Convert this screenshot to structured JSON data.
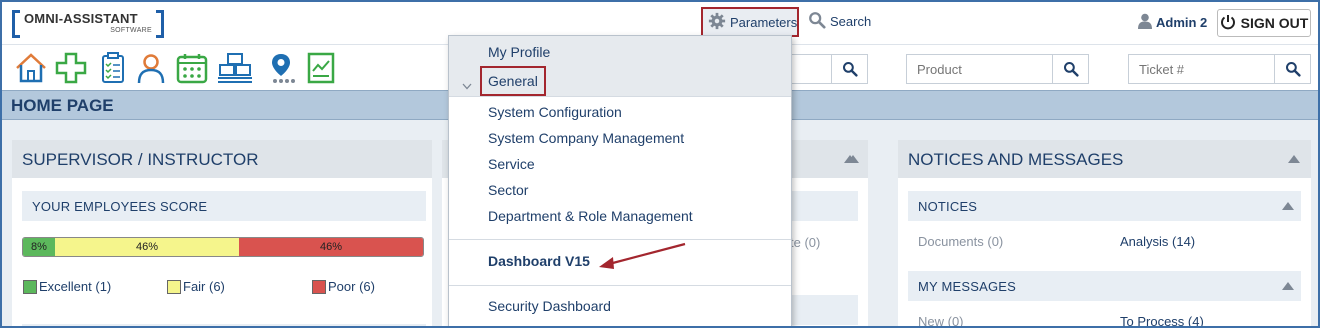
{
  "logo": {
    "line1": "OMNI-ASSISTANT",
    "line2": "SOFTWARE"
  },
  "topbar": {
    "parameters_label": "Parameters",
    "search_label": "Search",
    "user_name": "Admin 2",
    "signout_label": "SIGN OUT"
  },
  "toolbar": {
    "icons": [
      "home-icon",
      "add-cross-icon",
      "clipboard-checklist-icon",
      "person-icon",
      "calendar-icon",
      "pallets-icon",
      "location-pin-icon",
      "report-icon"
    ],
    "search_fields": [
      {
        "placeholder": ""
      },
      {
        "placeholder": "Product"
      },
      {
        "placeholder": "Ticket #"
      }
    ]
  },
  "page": {
    "title": "HOME PAGE"
  },
  "supervisor_panel": {
    "title": "SUPERVISOR / INSTRUCTOR",
    "employees_score_title": "YOUR EMPLOYEES SCORE",
    "score_segments": [
      {
        "label": "8%",
        "value": 8,
        "color": "#5cb85c"
      },
      {
        "label": "46%",
        "value": 46,
        "color": "#f5f58c"
      },
      {
        "label": "46%",
        "value": 46,
        "color": "#d9534f"
      }
    ],
    "legend": [
      {
        "label": "Excellent (1)",
        "color": "#5cb85c"
      },
      {
        "label": "Fair (6)",
        "color": "#f5f58c"
      },
      {
        "label": "Poor (6)",
        "color": "#d9534f"
      }
    ]
  },
  "middle_panel": {
    "partial_text": "te (0)"
  },
  "notices_panel": {
    "title": "NOTICES AND MESSAGES",
    "notices_title": "NOTICES",
    "documents": "Documents (0)",
    "analysis": "Analysis (14)",
    "messages_title": "MY MESSAGES",
    "new": "New (0)",
    "to_process": "To Process (4)"
  },
  "dropdown": {
    "my_profile": "My Profile",
    "general": "General",
    "items": [
      "System Configuration",
      "System Company Management",
      "Service",
      "Sector",
      "Department & Role Management"
    ],
    "dashboard_v15": "Dashboard V15",
    "security_dashboard": "Security Dashboard"
  },
  "colors": {
    "accent": "#1f3f6a",
    "highlight_border": "#a3262e",
    "header_band": "#b3c8dc"
  }
}
